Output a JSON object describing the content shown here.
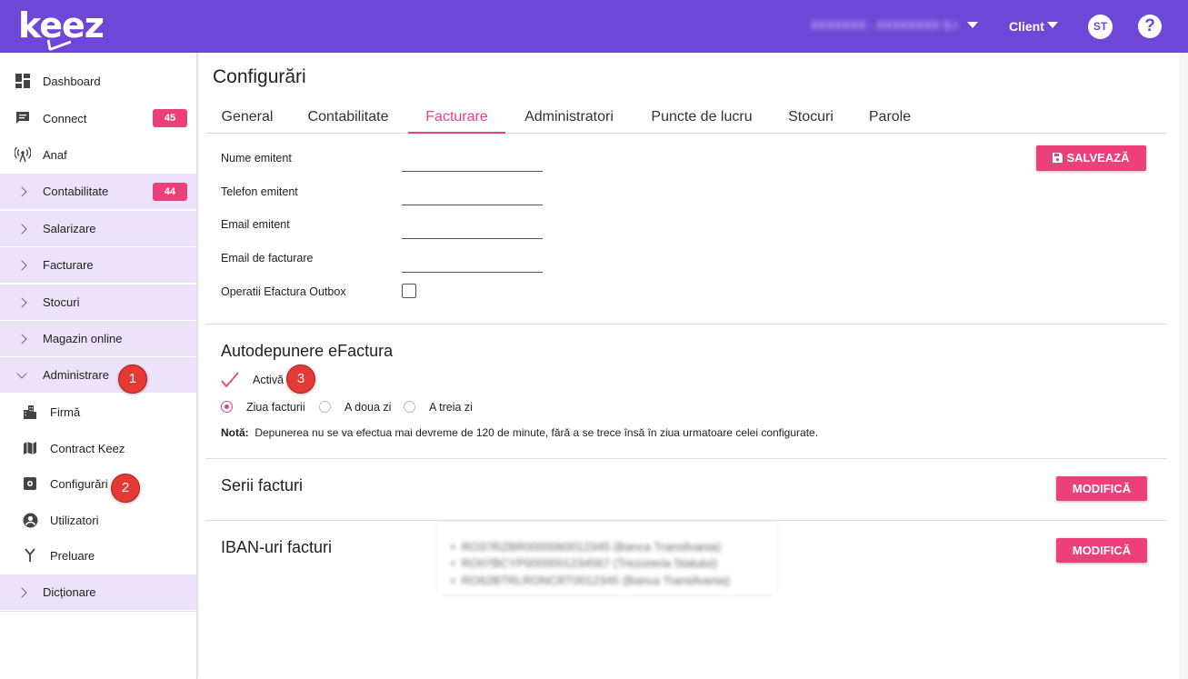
{
  "header": {
    "logo": "keez",
    "company": "XXXXXXX - XXXXXXXX S.R.L.",
    "client_label": "Client",
    "avatar_initials": "ST",
    "help_label": "?"
  },
  "sidebar": {
    "items": [
      {
        "label": "Dashboard",
        "icon": "dashboard-icon"
      },
      {
        "label": "Connect",
        "icon": "chat-icon",
        "badge": "45"
      },
      {
        "label": "Anaf",
        "icon": "antenna-icon"
      },
      {
        "label": "Contabilitate",
        "badge": "44"
      },
      {
        "label": "Salarizare"
      },
      {
        "label": "Facturare"
      },
      {
        "label": "Stocuri"
      },
      {
        "label": "Magazin online"
      },
      {
        "label": "Administrare"
      },
      {
        "label": "Firmă",
        "icon": "building-icon"
      },
      {
        "label": "Contract Keez",
        "icon": "map-icon"
      },
      {
        "label": "Configurări",
        "icon": "settings-icon"
      },
      {
        "label": "Utilizatori",
        "icon": "user-icon"
      },
      {
        "label": "Preluare",
        "icon": "merge-icon"
      },
      {
        "label": "Dicționare"
      }
    ]
  },
  "markers": [
    "1",
    "2",
    "3"
  ],
  "main": {
    "title": "Configurări",
    "tabs": [
      "General",
      "Contabilitate",
      "Facturare",
      "Administratori",
      "Puncte de lucru",
      "Stocuri",
      "Parole"
    ],
    "active_tab": "Facturare",
    "fields": {
      "nume_emitent": {
        "label": "Nume emitent",
        "value": ""
      },
      "telefon_emitent": {
        "label": "Telefon emitent",
        "value": ""
      },
      "email_emitent": {
        "label": "Email emitent",
        "value": ""
      },
      "email_facturare": {
        "label": "Email de facturare",
        "value": ""
      },
      "operatii_outbox": {
        "label": "Operatii Efactura Outbox",
        "checked": false
      }
    },
    "save_button": "SALVEAZĂ",
    "autodepunere": {
      "title": "Autodepunere eFactura",
      "active_label": "Activă",
      "active_checked": true,
      "options": [
        "Ziua facturii",
        "A doua zi",
        "A treia zi"
      ],
      "selected_option": "Ziua facturii",
      "note_label": "Notă:",
      "note_text": "Depunerea nu se va efectua mai devreme de 120 de minute, fără a se trece însă în ziua urmatoare celei configurate."
    },
    "serii": {
      "title": "Serii facturi",
      "button": "MODIFICĂ"
    },
    "iban": {
      "title": "IBAN-uri facturi",
      "button": "MODIFICĂ",
      "items": [
        "RO37RZBR0000060012345 (Banca Transilvania)",
        "RO07BCYP0000001234567 (Trezoreria Statului)",
        "RO62BTRLRONCRT0012345 (Banca Transilvania)"
      ]
    }
  },
  "colors": {
    "header": "#6f47d8",
    "accent": "#ec407a",
    "sidebar_group": "#ece3fa"
  }
}
